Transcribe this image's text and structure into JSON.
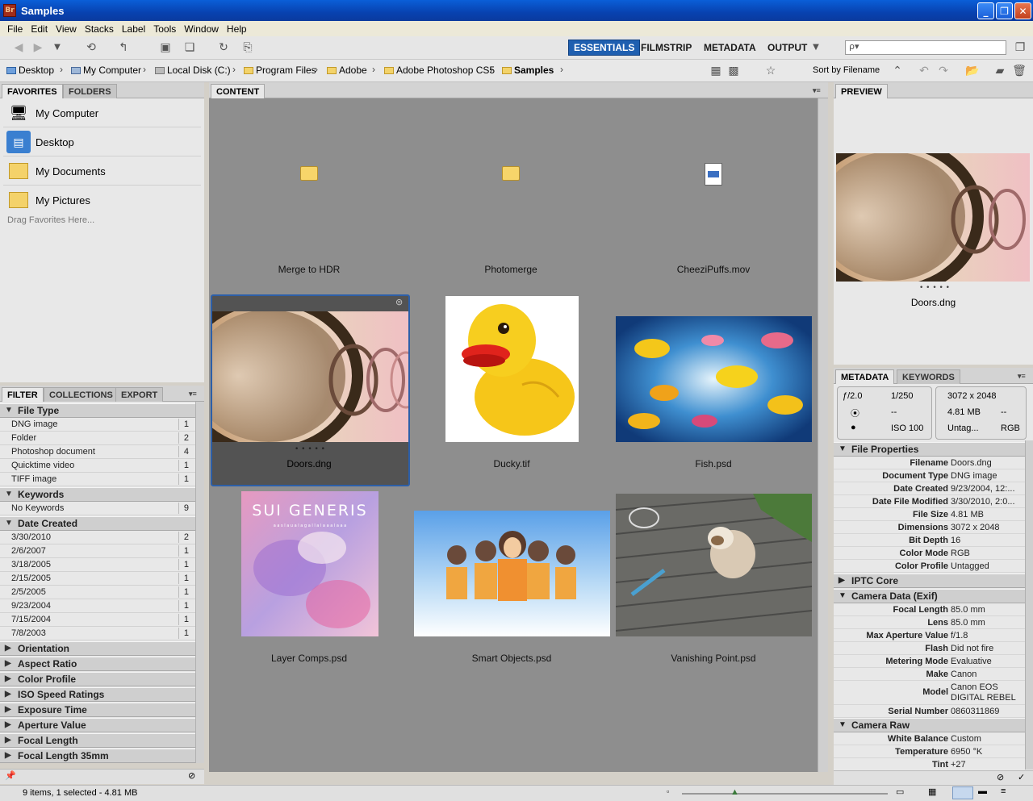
{
  "window": {
    "title": "Samples",
    "app_badge": "Br"
  },
  "menu": [
    "File",
    "Edit",
    "View",
    "Stacks",
    "Label",
    "Tools",
    "Window",
    "Help"
  ],
  "workspaces": [
    "ESSENTIALS",
    "FILMSTRIP",
    "METADATA",
    "OUTPUT"
  ],
  "search": {
    "placeholder": "ρ▾"
  },
  "path": [
    "Desktop",
    "My Computer",
    "Local Disk (C:)",
    "Program Files",
    "Adobe",
    "Adobe Photoshop CS5",
    "Samples"
  ],
  "sort_label": "Sort by Filename",
  "left_tabs": [
    "FAVORITES",
    "FOLDERS"
  ],
  "favorites": [
    "My Computer",
    "Desktop",
    "My Documents",
    "My Pictures"
  ],
  "favorites_hint": "Drag Favorites Here...",
  "filter_tabs": [
    "FILTER",
    "COLLECTIONS",
    "EXPORT"
  ],
  "filter": {
    "file_type": {
      "title": "File Type",
      "items": [
        [
          "DNG image",
          "1"
        ],
        [
          "Folder",
          "2"
        ],
        [
          "Photoshop document",
          "4"
        ],
        [
          "Quicktime video",
          "1"
        ],
        [
          "TIFF image",
          "1"
        ]
      ]
    },
    "keywords": {
      "title": "Keywords",
      "items": [
        [
          "No Keywords",
          "9"
        ]
      ]
    },
    "date_created": {
      "title": "Date Created",
      "items": [
        [
          "3/30/2010",
          "2"
        ],
        [
          "2/6/2007",
          "1"
        ],
        [
          "3/18/2005",
          "1"
        ],
        [
          "2/15/2005",
          "1"
        ],
        [
          "2/5/2005",
          "1"
        ],
        [
          "9/23/2004",
          "1"
        ],
        [
          "7/15/2004",
          "1"
        ],
        [
          "7/8/2003",
          "1"
        ]
      ]
    },
    "collapsed": [
      "Orientation",
      "Aspect Ratio",
      "Color Profile",
      "ISO Speed Ratings",
      "Exposure Time",
      "Aperture Value",
      "Focal Length",
      "Focal Length 35mm"
    ]
  },
  "content_tab": "CONTENT",
  "items": [
    "Merge to HDR",
    "Photomerge",
    "CheeziPuffs.mov",
    "Doors.dng",
    "Ducky.tif",
    "Fish.psd",
    "Layer Comps.psd",
    "Smart Objects.psd",
    "Vanishing Point.psd"
  ],
  "rating_dots": "• • • • •",
  "sui_generis": {
    "title": "SUI GENERIS",
    "sub": "a a s l a u a l a g a l l a l a a a l a a a"
  },
  "preview": {
    "tab": "PREVIEW",
    "caption": "Doors.dng"
  },
  "meta_tabs": [
    "METADATA",
    "KEYWORDS"
  ],
  "camera_summary": {
    "aperture": "ƒ/2.0",
    "shutter": "1/250",
    "metering": "--",
    "iso": "ISO 100",
    "dims": "3072 x 2048",
    "size": "4.81 MB",
    "size_extra": "--",
    "tag": "Untag...",
    "mode": "RGB"
  },
  "file_properties": {
    "title": "File Properties",
    "rows": [
      [
        "Filename",
        "Doors.dng"
      ],
      [
        "Document Type",
        "DNG image"
      ],
      [
        "Date Created",
        "9/23/2004, 12:..."
      ],
      [
        "Date File Modified",
        "3/30/2010, 2:0..."
      ],
      [
        "File Size",
        "4.81 MB"
      ],
      [
        "Dimensions",
        "3072 x 2048"
      ],
      [
        "Bit Depth",
        "16"
      ],
      [
        "Color Mode",
        "RGB"
      ],
      [
        "Color Profile",
        "Untagged"
      ]
    ]
  },
  "iptc": "IPTC Core",
  "camera_exif": {
    "title": "Camera Data (Exif)",
    "rows": [
      [
        "Focal Length",
        "85.0 mm"
      ],
      [
        "Lens",
        "85.0 mm"
      ],
      [
        "Max Aperture Value",
        "f/1.8"
      ],
      [
        "Flash",
        "Did not fire"
      ],
      [
        "Metering Mode",
        "Evaluative"
      ],
      [
        "Make",
        "Canon"
      ],
      [
        "Model",
        "Canon EOS DIGITAL REBEL"
      ],
      [
        "Serial Number",
        "0860311869"
      ]
    ]
  },
  "camera_raw": {
    "title": "Camera Raw",
    "rows": [
      [
        "White Balance",
        "Custom"
      ],
      [
        "Temperature",
        "6950 °K"
      ],
      [
        "Tint",
        "+27"
      ]
    ]
  },
  "status": "9 items, 1 selected - 4.81 MB"
}
